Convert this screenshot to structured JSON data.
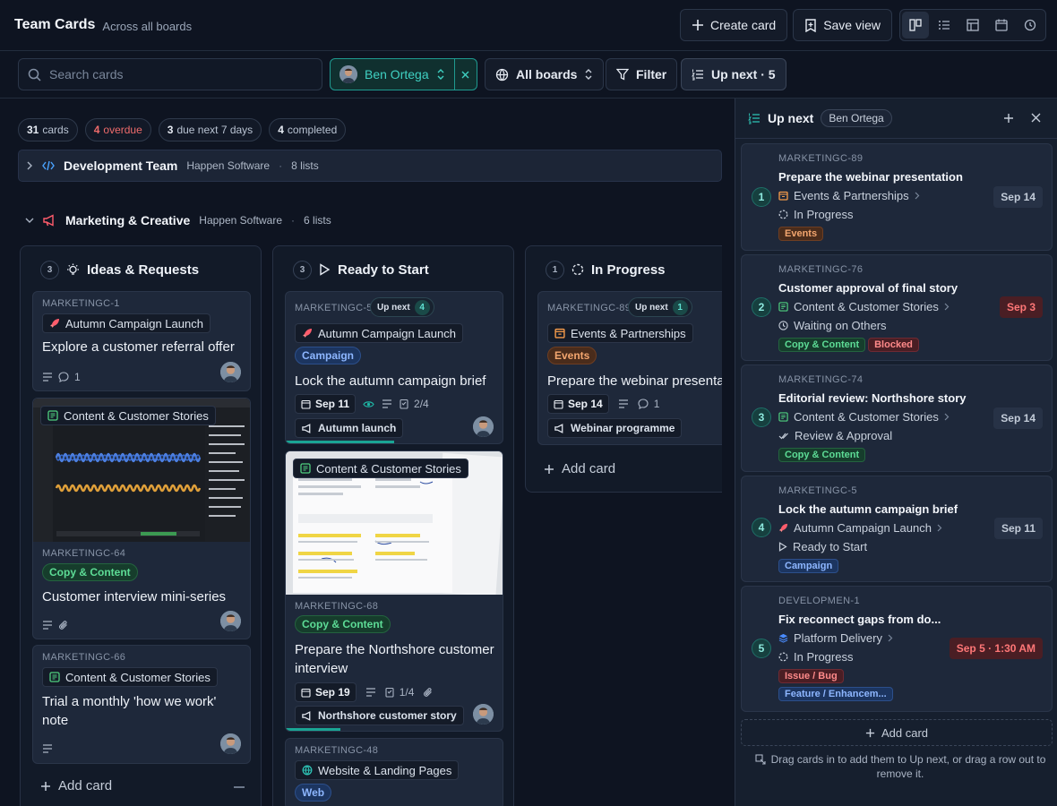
{
  "header": {
    "title": "Team Cards",
    "subtitle": "Across all boards",
    "create_label": "Create card",
    "save_label": "Save view",
    "view_icons": [
      "board-view-icon",
      "list-view-icon",
      "table-view-icon",
      "calendar-view-icon",
      "history-icon"
    ]
  },
  "filters": {
    "search_placeholder": "Search cards",
    "user": "Ben Ortega",
    "boards": "All boards",
    "filter_label": "Filter",
    "upnext_label": "Up next · 5"
  },
  "stats": [
    {
      "n": "31",
      "label": "cards"
    },
    {
      "n": "4",
      "label": "overdue"
    },
    {
      "n": "3",
      "label": "due next 7 days"
    },
    {
      "n": "4",
      "label": "completed"
    }
  ],
  "boards": {
    "dev": {
      "name": "Development Team",
      "org": "Happen Software",
      "lists": "8 lists"
    },
    "mkt": {
      "name": "Marketing & Creative",
      "org": "Happen Software",
      "lists": "6 lists"
    }
  },
  "columns": [
    {
      "count": "3",
      "title": "Ideas & Requests",
      "add": "Add card"
    },
    {
      "count": "3",
      "title": "Ready to Start"
    },
    {
      "count": "1",
      "title": "In Progress",
      "add": "Add card"
    }
  ],
  "cards": {
    "c1": {
      "key": "MARKETINGC-1",
      "tag": "Autumn Campaign Launch",
      "title": "Explore a customer referral offer",
      "comments": "1"
    },
    "c2": {
      "tag": "Content & Customer Stories",
      "key": "MARKETINGC-64",
      "pill": "Copy & Content",
      "title": "Customer interview mini-series"
    },
    "c3": {
      "key": "MARKETINGC-66",
      "tag": "Content & Customer Stories",
      "title": "Trial a monthly 'how we work' note"
    },
    "c4": {
      "key": "MARKETINGC-5",
      "upnext": "Up next",
      "upnext_n": "4",
      "tag": "Autumn Campaign Launch",
      "pill": "Campaign",
      "title": "Lock the autumn campaign brief",
      "date": "Sep 11",
      "checklist": "2/4",
      "milestone": "Autumn launch",
      "progress": 0.5
    },
    "c5": {
      "tag": "Content & Customer Stories",
      "key": "MARKETINGC-68",
      "pill": "Copy & Content",
      "title": "Prepare the Northshore customer interview",
      "date": "Sep 19",
      "checklist": "1/4",
      "milestone": "Northshore customer story",
      "progress": 0.25
    },
    "c6": {
      "key": "MARKETINGC-48",
      "tag": "Website & Landing Pages",
      "pill": "Web"
    },
    "c7": {
      "key": "MARKETINGC-89",
      "upnext": "Up next",
      "upnext_n": "1",
      "tag": "Events & Partnerships",
      "pill": "Events",
      "title": "Prepare the webinar presentation",
      "date": "Sep 14",
      "comments": "1",
      "milestone": "Webinar programme"
    }
  },
  "panel": {
    "title": "Up next",
    "user": "Ben Ortega",
    "items": [
      {
        "n": "1",
        "key": "MARKETINGC-89",
        "title": "Prepare the webinar presentation",
        "board": "Events & Partnerships",
        "status": "In Progress",
        "tags": [
          "Events"
        ],
        "date": "Sep 14"
      },
      {
        "n": "2",
        "key": "MARKETINGC-76",
        "title": "Customer approval of final story",
        "board": "Content & Customer Stories",
        "status": "Waiting on Others",
        "tags": [
          "Copy & Content",
          "Blocked"
        ],
        "date": "Sep 3"
      },
      {
        "n": "3",
        "key": "MARKETINGC-74",
        "title": "Editorial review: Northshore story",
        "board": "Content & Customer Stories",
        "status": "Review & Approval",
        "tags": [
          "Copy & Content"
        ],
        "date": "Sep 14"
      },
      {
        "n": "4",
        "key": "MARKETINGC-5",
        "title": "Lock the autumn campaign brief",
        "board": "Autumn Campaign Launch",
        "status": "Ready to Start",
        "tags": [
          "Campaign"
        ],
        "date": "Sep 11"
      },
      {
        "n": "5",
        "key": "DEVELOPMEN-1",
        "title": "Fix reconnect gaps from do...",
        "board": "Platform Delivery",
        "status": "In Progress",
        "tags": [
          "Issue / Bug",
          "Feature / Enhancem..."
        ],
        "date": "Sep 5 · 1:30 AM"
      }
    ],
    "add_label": "Add card",
    "hint": "Drag cards in to add them to Up next, or drag a row out to remove it."
  },
  "colors": {
    "accent": "#1aa594",
    "bg": "#0e1421",
    "overdue": "#ee6b6b"
  }
}
